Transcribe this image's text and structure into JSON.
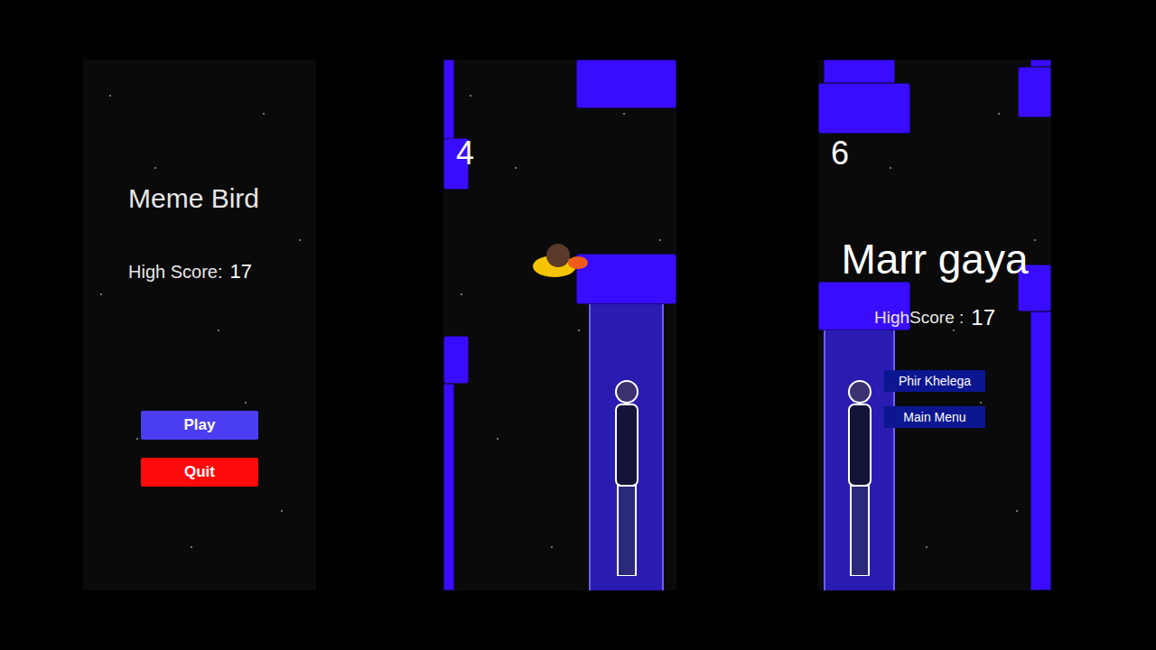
{
  "menu_screen": {
    "title": "Meme Bird",
    "high_score_label": "High Score:",
    "high_score": "17",
    "buttons": [
      {
        "label": "Play",
        "color": "#4b3ef2"
      },
      {
        "label": "Quit",
        "color": "#ff0a0a"
      }
    ]
  },
  "game_screen": {
    "score": "4"
  },
  "game_over_screen": {
    "score": "6",
    "title": "Marr gaya",
    "high_score_label": "HighScore :",
    "high_score": "17",
    "buttons": [
      {
        "label": "Phir Khelega"
      },
      {
        "label": "Main Menu"
      }
    ]
  }
}
